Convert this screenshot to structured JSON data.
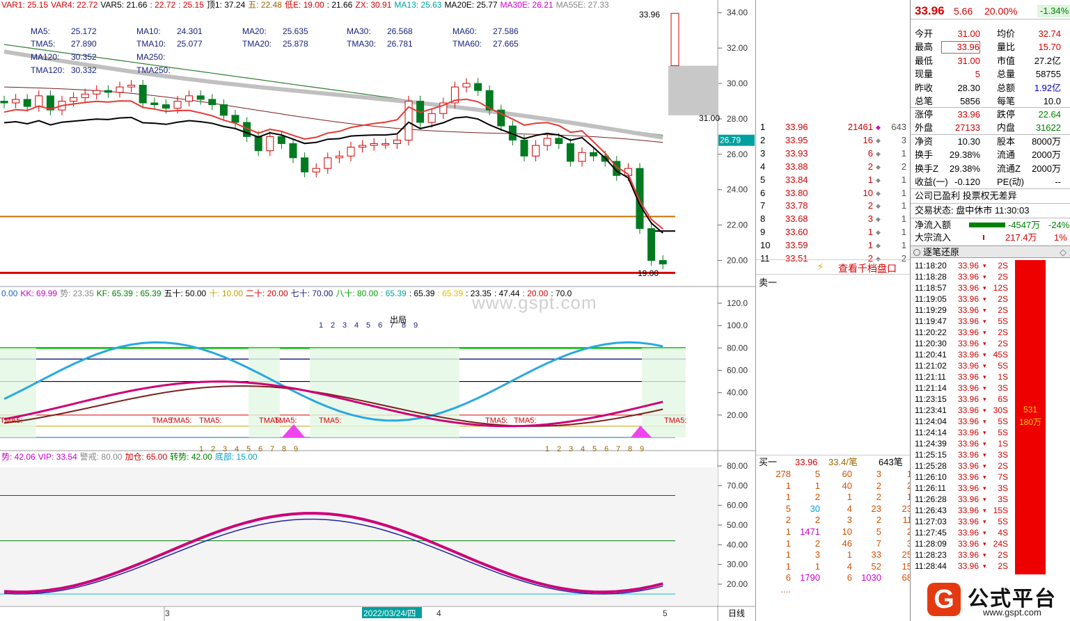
{
  "top_indicator": {
    "items": [
      {
        "text": "VAR1: 25.15",
        "color": "#d40000"
      },
      {
        "text": "VAR4: 22.72",
        "color": "#d40000"
      },
      {
        "text": "VAR5: 21.66",
        "color": "#000000"
      },
      {
        "text": ": 22.72",
        "color": "#d40000"
      },
      {
        "text": ": 25.15",
        "color": "#d40000"
      },
      {
        "text": "顶1: 37.24",
        "color": "#000000"
      },
      {
        "text": "五: 22.48",
        "color": "#996600"
      },
      {
        "text": "低E: 19.00",
        "color": "#d40000"
      },
      {
        "text": ": 21.66",
        "color": "#000000"
      },
      {
        "text": "ZX: 30.91",
        "color": "#d40000"
      },
      {
        "text": "MA13: 25.63",
        "color": "#00a0a0"
      },
      {
        "text": "MA20E: 25.77",
        "color": "#000000"
      },
      {
        "text": "MA30E: 26.21",
        "color": "#cc00cc"
      },
      {
        "text": "MA55E: 27.33",
        "color": "#888888"
      }
    ]
  },
  "ma_table": [
    {
      "label": "MA5:",
      "value": "25.172"
    },
    {
      "label": "MA10:",
      "value": "24.301"
    },
    {
      "label": "MA20:",
      "value": "25.635"
    },
    {
      "label": "MA30:",
      "value": "26.568"
    },
    {
      "label": "MA60:",
      "value": "27.586"
    },
    {
      "label": "TMA5:",
      "value": "27.890"
    },
    {
      "label": "TMA10:",
      "value": "25.077"
    },
    {
      "label": "TMA20:",
      "value": "25.878"
    },
    {
      "label": "TMA30:",
      "value": "26.781"
    },
    {
      "label": "TMA60:",
      "value": "27.665"
    },
    {
      "label": "MA120:",
      "value": "30.352"
    },
    {
      "label": "MA250:",
      "value": ""
    },
    {
      "label": "TMA120:",
      "value": "30.332"
    },
    {
      "label": "TMA250:",
      "value": ""
    }
  ],
  "price_axis": [
    "34.00",
    "32.00",
    "30.00",
    "28.00",
    "26.00",
    "24.00",
    "22.00",
    "20.00"
  ],
  "price_tag": "26.79",
  "high_label": "33.96",
  "low_label": "19.00",
  "current_line_label": "31.00",
  "mid_indicator": {
    "items": [
      {
        "text": "0.00",
        "color": "#1565c0"
      },
      {
        "text": "KK: 69.99",
        "color": "#cc00cc"
      },
      {
        "text": "势: 23.35",
        "color": "#888888"
      },
      {
        "text": "KF: 65.39",
        "color": "#008000"
      },
      {
        "text": ": 65.39",
        "color": "#008000"
      },
      {
        "text": "五十: 50.00",
        "color": "#000000"
      },
      {
        "text": "十: 10.00",
        "color": "#c0a000"
      },
      {
        "text": "二十: 20.00",
        "color": "#d40000"
      },
      {
        "text": "七十: 70.00",
        "color": "#1a237e"
      },
      {
        "text": "八十: 80.00",
        "color": "#00a000"
      },
      {
        "text": ": 65.39",
        "color": "#00a0a0"
      },
      {
        "text": ": 65.39",
        "color": "#000000"
      },
      {
        "text": ": 65.39",
        "color": "#e0c000"
      },
      {
        "text": ": 23.35",
        "color": "#000000"
      },
      {
        "text": ": 47.44",
        "color": "#000000"
      },
      {
        "text": ": 20.00",
        "color": "#d40000"
      },
      {
        "text": ": 70.0",
        "color": "#000000"
      }
    ],
    "axis": [
      "120.0",
      "100.0",
      "80.00",
      "60.00",
      "40.00",
      "20.00"
    ],
    "count_labels_top": [
      "1",
      "2",
      "3",
      "4",
      "5",
      "6",
      "7",
      "8",
      "9"
    ],
    "exit_label": "出局",
    "count_labels_bottom_a": [
      "1",
      "2",
      "3",
      "4",
      "5",
      "6",
      "7",
      "8",
      "9"
    ],
    "count_labels_bottom_b": [
      "1",
      "2",
      "3",
      "4",
      "5",
      "6",
      "7",
      "8",
      "9"
    ],
    "tma_labels": [
      "TMA5:",
      "TMA5:",
      "TMA5:",
      "TMA5:",
      "TMA5:",
      "TMA5:",
      "TMA5:",
      "TMA5:",
      "TMA5:"
    ]
  },
  "watermark": "www.gspt.com",
  "bottom_indicator": {
    "items": [
      {
        "text": "势: 42.06",
        "color": "#cc00cc"
      },
      {
        "text": "VIP: 33.54",
        "color": "#cc00cc"
      },
      {
        "text": "警戒: 80.00",
        "color": "#888888"
      },
      {
        "text": "加仓: 65.00",
        "color": "#d40000"
      },
      {
        "text": "转势: 42.00",
        "color": "#008000"
      },
      {
        "text": "底部: 15.00",
        "color": "#00a0c0"
      }
    ],
    "axis": [
      "80.00",
      "70.00",
      "60.00",
      "50.00",
      "40.00",
      "30.00",
      "20.00"
    ]
  },
  "time_axis": {
    "labels": [
      "3",
      "2022/03/24/四",
      "4",
      "5"
    ],
    "period": "日线"
  },
  "order_book": {
    "sells": [
      {
        "n": "1",
        "price": "33.96",
        "vol": "21461",
        "cnt": "643"
      },
      {
        "n": "2",
        "price": "33.95",
        "vol": "16",
        "cnt": "3"
      },
      {
        "n": "3",
        "price": "33.93",
        "vol": "6",
        "cnt": "1"
      },
      {
        "n": "4",
        "price": "33.88",
        "vol": "2",
        "cnt": "2"
      },
      {
        "n": "5",
        "price": "33.84",
        "vol": "1",
        "cnt": "1"
      },
      {
        "n": "6",
        "price": "33.80",
        "vol": "10",
        "cnt": "1"
      },
      {
        "n": "7",
        "price": "33.78",
        "vol": "2",
        "cnt": "1"
      },
      {
        "n": "8",
        "price": "33.68",
        "vol": "3",
        "cnt": "1"
      },
      {
        "n": "9",
        "price": "33.60",
        "vol": "1",
        "cnt": "1"
      },
      {
        "n": "10",
        "price": "33.59",
        "vol": "1",
        "cnt": "1"
      },
      {
        "n": "11",
        "price": "33.51",
        "vol": "2",
        "cnt": "2"
      }
    ],
    "link": "查看千档盘口",
    "sell1_label": "卖一",
    "buy1": {
      "label": "买一",
      "price": "33.96",
      "avg": "33.4/笔",
      "count": "643笔"
    },
    "queue": [
      [
        "278",
        "5",
        "60",
        "3",
        "1"
      ],
      [
        "1",
        "1",
        "40",
        "2",
        "2"
      ],
      [
        "1",
        "2",
        "1",
        "2",
        "1"
      ],
      [
        "5",
        "30",
        "4",
        "23",
        "23"
      ],
      [
        "2",
        "2",
        "3",
        "2",
        "11"
      ],
      [
        "1",
        "1471",
        "10",
        "5",
        "2"
      ],
      [
        "1",
        "2",
        "46",
        "7",
        "3"
      ],
      [
        "1",
        "3",
        "1",
        "33",
        "25"
      ],
      [
        "1",
        "1",
        "4",
        "52",
        "15"
      ],
      [
        "6",
        "1790",
        "6",
        "1030",
        "68"
      ],
      [
        "....",
        "",
        "",
        "",
        ""
      ]
    ]
  },
  "quote": {
    "price": "33.96",
    "change": "5.66",
    "pct": "20.00%",
    "other_pct": "-1.34%",
    "rows": [
      {
        "l1": "今开",
        "v1": "31.00",
        "l2": "均价",
        "v2": "32.74",
        "c1": "red",
        "c2": "red"
      },
      {
        "l1": "最高",
        "v1": "33.96",
        "l2": "量比",
        "v2": "15.70",
        "c1": "red",
        "c2": "red"
      },
      {
        "l1": "最低",
        "v1": "31.00",
        "l2": "市值",
        "v2": "27.2亿",
        "c1": "red",
        "c2": "black"
      },
      {
        "l1": "现量",
        "v1": "5",
        "l2": "总量",
        "v2": "58755",
        "c1": "red",
        "c2": "black"
      },
      {
        "l1": "昨收",
        "v1": "28.30",
        "l2": "总额",
        "v2": "1.92亿",
        "c1": "black",
        "c2": "blue"
      },
      {
        "l1": "总笔",
        "v1": "5856",
        "l2": "每笔",
        "v2": "10.0",
        "c1": "black",
        "c2": "black"
      }
    ],
    "rows2": [
      {
        "l1": "涨停",
        "v1": "33.96",
        "l2": "跌停",
        "v2": "22.64",
        "c1": "red",
        "c2": "green"
      },
      {
        "l1": "外盘",
        "v1": "27133",
        "l2": "内盘",
        "v2": "31622",
        "c1": "red",
        "c2": "green"
      }
    ],
    "rows3": [
      {
        "l1": "净资",
        "v1": "10.30",
        "l2": "股本",
        "v2": "8000万",
        "c1": "black",
        "c2": "black"
      },
      {
        "l1": "换手",
        "v1": "29.38%",
        "l2": "流通",
        "v2": "2000万",
        "c1": "black",
        "c2": "black"
      },
      {
        "l1": "换手Z",
        "v1": "29.38%",
        "l2": "流通Z",
        "v2": "2000万",
        "c1": "black",
        "c2": "black"
      },
      {
        "l1": "收益(一)",
        "v1": "-0.120",
        "l2": "PE(动)",
        "v2": "--",
        "c1": "black",
        "c2": "black"
      }
    ],
    "profit": "公司已盈利 投票权无差异",
    "status": "交易状态: 盘中休市 11:30:03",
    "net_inflow_label": "净流入额",
    "net_inflow_value": "-4547万",
    "net_inflow_pct": "-24%",
    "block_label": "大宗流入",
    "block_value": "217.4万",
    "block_pct": "1%",
    "ticks_title": "逐笔还原",
    "ticks": [
      {
        "t": "11:18:20",
        "p": "33.96",
        "v": "2S"
      },
      {
        "t": "11:18:28",
        "p": "33.96",
        "v": "2S"
      },
      {
        "t": "11:18:57",
        "p": "33.96",
        "v": "12S"
      },
      {
        "t": "11:19:05",
        "p": "33.96",
        "v": "2S"
      },
      {
        "t": "11:19:29",
        "p": "33.96",
        "v": "2S"
      },
      {
        "t": "11:19:47",
        "p": "33.96",
        "v": "5S"
      },
      {
        "t": "11:20:22",
        "p": "33.96",
        "v": "2S"
      },
      {
        "t": "11:20:30",
        "p": "33.96",
        "v": "2S"
      },
      {
        "t": "11:20:41",
        "p": "33.96",
        "v": "45S"
      },
      {
        "t": "11:21:02",
        "p": "33.96",
        "v": "5S"
      },
      {
        "t": "11:21:11",
        "p": "33.96",
        "v": "1S"
      },
      {
        "t": "11:21:14",
        "p": "33.96",
        "v": "3S"
      },
      {
        "t": "11:23:15",
        "p": "33.96",
        "v": "6S"
      },
      {
        "t": "11:23:41",
        "p": "33.96",
        "v": "30S"
      },
      {
        "t": "11:24:04",
        "p": "33.96",
        "v": "5S"
      },
      {
        "t": "11:24:14",
        "p": "33.96",
        "v": "5S"
      },
      {
        "t": "11:24:39",
        "p": "33.96",
        "v": "1S"
      },
      {
        "t": "11:25:15",
        "p": "33.96",
        "v": "3S"
      },
      {
        "t": "11:25:28",
        "p": "33.96",
        "v": "2S"
      },
      {
        "t": "11:26:10",
        "p": "33.96",
        "v": "7S"
      },
      {
        "t": "11:26:11",
        "p": "33.96",
        "v": "3S"
      },
      {
        "t": "11:26:28",
        "p": "33.96",
        "v": "3S"
      },
      {
        "t": "11:26:43",
        "p": "33.96",
        "v": "15S"
      },
      {
        "t": "11:27:03",
        "p": "33.96",
        "v": "5S"
      },
      {
        "t": "11:27:45",
        "p": "33.96",
        "v": "4S"
      },
      {
        "t": "11:28:09",
        "p": "33.96",
        "v": "24S"
      },
      {
        "t": "11:28:23",
        "p": "33.96",
        "v": "2S"
      },
      {
        "t": "11:28:44",
        "p": "33.96",
        "v": "2S"
      }
    ],
    "bar_label1": "531",
    "bar_label2": "180万",
    "right_edge_values": [
      "1",
      "2",
      "12",
      "2",
      "45",
      "5",
      "1",
      "1",
      "3",
      "2",
      "1"
    ]
  },
  "logo": {
    "mark": "G",
    "title": "公式平台",
    "url": "www.gspt.com"
  }
}
